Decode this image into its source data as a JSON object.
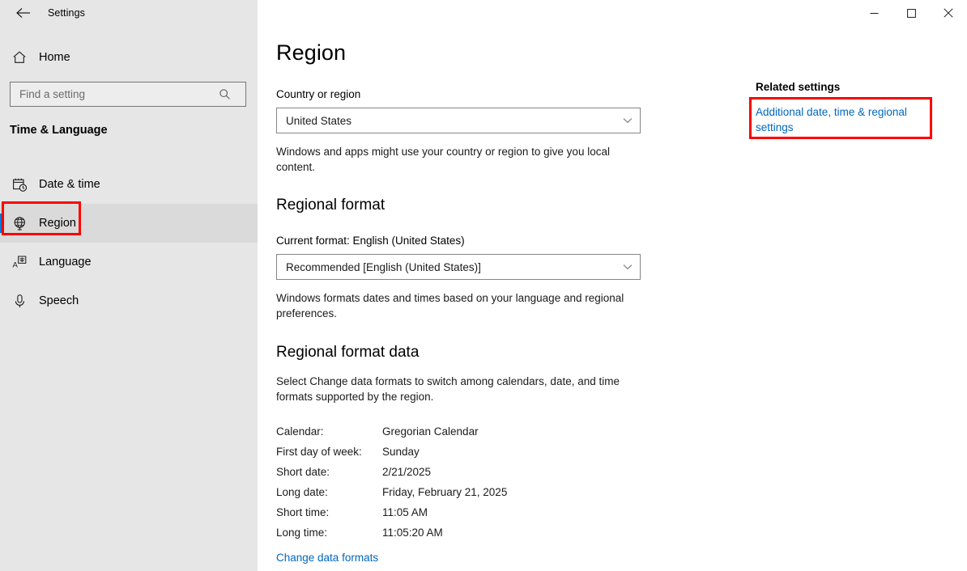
{
  "titlebar": {
    "back_label": "back-arrow",
    "title": "Settings",
    "minimize": "—",
    "maximize": "□",
    "close": "✕"
  },
  "sidebar": {
    "home_label": "Home",
    "search": {
      "placeholder": "Find a setting",
      "value": ""
    },
    "group_title": "Time & Language",
    "items": [
      {
        "label": "Date & time",
        "icon": "calendar-clock-icon",
        "selected": false
      },
      {
        "label": "Region",
        "icon": "globe-icon",
        "selected": true
      },
      {
        "label": "Language",
        "icon": "language-icon",
        "selected": false
      },
      {
        "label": "Speech",
        "icon": "microphone-icon",
        "selected": false
      }
    ]
  },
  "main": {
    "page_title": "Region",
    "country": {
      "label": "Country or region",
      "value": "United States",
      "description": "Windows and apps might use your country or region to give you local content."
    },
    "regional_format": {
      "heading": "Regional format",
      "current_label": "Current format: English (United States)",
      "value": "Recommended [English (United States)]",
      "description": "Windows formats dates and times based on your language and regional preferences."
    },
    "format_data": {
      "heading": "Regional format data",
      "description": "Select Change data formats to switch among calendars, date, and time formats supported by the region.",
      "rows": [
        {
          "key": "Calendar:",
          "value": "Gregorian Calendar"
        },
        {
          "key": "First day of week:",
          "value": "Sunday"
        },
        {
          "key": "Short date:",
          "value": "2/21/2025"
        },
        {
          "key": "Long date:",
          "value": "Friday, February 21, 2025"
        },
        {
          "key": "Short time:",
          "value": "11:05 AM"
        },
        {
          "key": "Long time:",
          "value": "11:05:20 AM"
        }
      ],
      "change_link": "Change data formats"
    }
  },
  "related_settings": {
    "heading": "Related settings",
    "link": "Additional date, time & regional settings"
  },
  "colors": {
    "sidebar_bg": "#e6e6e6",
    "content_bg": "#ffffff",
    "accent": "#0078d4",
    "link": "#0067c0",
    "highlight_box": "#ff0000",
    "field_border": "#868686"
  }
}
